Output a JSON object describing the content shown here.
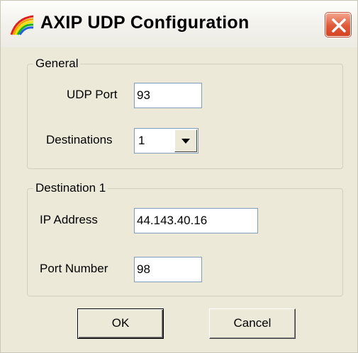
{
  "window": {
    "title": "AXIP UDP Configuration"
  },
  "general": {
    "legend": "General",
    "udp_port_label": "UDP Port",
    "udp_port_value": "93",
    "destinations_label": "Destinations",
    "destinations_value": "1"
  },
  "destination": {
    "legend": "Destination 1",
    "ip_label": "IP Address",
    "ip_value": "44.143.40.16",
    "port_label": "Port Number",
    "port_value": "98"
  },
  "buttons": {
    "ok": "OK",
    "cancel": "Cancel"
  },
  "colors": {
    "close_button": "#d44422",
    "face": "#ece9d8",
    "field_border": "#7f9db9"
  },
  "icons": {
    "app": "rainbow-feather-icon",
    "close": "close-icon",
    "dropdown": "chevron-down-icon"
  }
}
